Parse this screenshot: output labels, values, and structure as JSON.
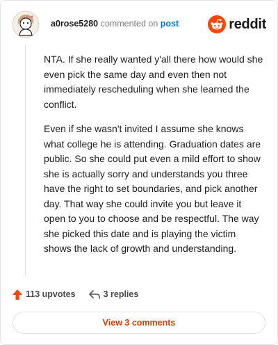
{
  "header": {
    "username": "a0rose5280",
    "action_text": "commented on",
    "post_link": "post",
    "brand": "reddit"
  },
  "comment": {
    "paragraphs": [
      "NTA. If she really wanted y'all there how would she even pick the same day and even then not immediately rescheduling when she learned the conflict.",
      "Even if she wasn't invited I assume she knows what college he is attending. Graduation dates are public. So she could put even a mild effort to show she is actually sorry and understands you three have the right to set boundaries, and pick another day. That way she could invite you but leave it open to you to choose and be respectful. The way she picked this date and is playing the victim shows the lack of growth and understanding."
    ]
  },
  "footer": {
    "upvotes_label": "113 upvotes",
    "replies_label": "3 replies",
    "view_comments_label": "View 3 comments"
  },
  "colors": {
    "upvote_accent": "#ff4500",
    "view_button_text": "#d93a00",
    "link": "#0079d3"
  },
  "icons": [
    "avatar-icon",
    "reddit-logo-icon",
    "upvote-arrow-icon",
    "reply-icon"
  ]
}
